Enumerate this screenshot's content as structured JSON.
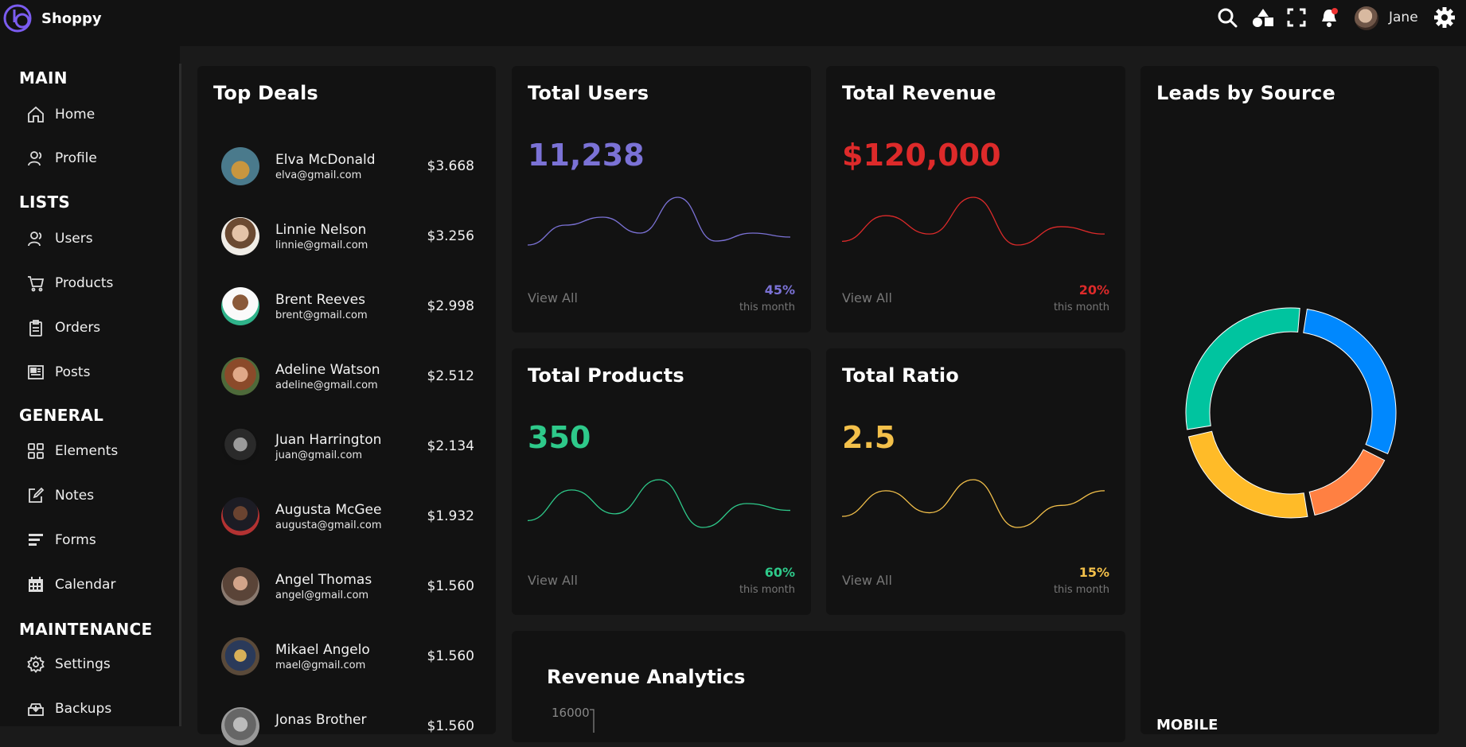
{
  "app": {
    "name": "Shoppy"
  },
  "topbar": {
    "icons": [
      "search-icon",
      "apps-icon",
      "fullscreen-icon",
      "notification-bell-icon",
      "settings-gear-icon"
    ],
    "user_name": "Jane"
  },
  "sidebar": {
    "sections": [
      {
        "title": "MAIN",
        "items": [
          {
            "label": "Home",
            "icon": "home-icon"
          },
          {
            "label": "Profile",
            "icon": "profile-icon"
          }
        ]
      },
      {
        "title": "LISTS",
        "items": [
          {
            "label": "Users",
            "icon": "users-icon"
          },
          {
            "label": "Products",
            "icon": "cart-icon"
          },
          {
            "label": "Orders",
            "icon": "clipboard-icon"
          },
          {
            "label": "Posts",
            "icon": "newspaper-icon"
          }
        ]
      },
      {
        "title": "GENERAL",
        "items": [
          {
            "label": "Elements",
            "icon": "grid-icon"
          },
          {
            "label": "Notes",
            "icon": "edit-icon"
          },
          {
            "label": "Forms",
            "icon": "forms-icon"
          },
          {
            "label": "Calendar",
            "icon": "calendar-icon"
          }
        ]
      },
      {
        "title": "MAINTENANCE",
        "items": [
          {
            "label": "Settings",
            "icon": "settings-icon"
          },
          {
            "label": "Backups",
            "icon": "backup-icon"
          }
        ]
      }
    ]
  },
  "top_deals": {
    "title": "Top Deals",
    "deals": [
      {
        "name": "Elva McDonald",
        "email": "elva@gmail.com",
        "amount": "$3.668"
      },
      {
        "name": "Linnie Nelson",
        "email": "linnie@gmail.com",
        "amount": "$3.256"
      },
      {
        "name": "Brent Reeves",
        "email": "brent@gmail.com",
        "amount": "$2.998"
      },
      {
        "name": "Adeline Watson",
        "email": "adeline@gmail.com",
        "amount": "$2.512"
      },
      {
        "name": "Juan Harrington",
        "email": "juan@gmail.com",
        "amount": "$2.134"
      },
      {
        "name": "Augusta McGee",
        "email": "augusta@gmail.com",
        "amount": "$1.932"
      },
      {
        "name": "Angel Thomas",
        "email": "angel@gmail.com",
        "amount": "$1.560"
      },
      {
        "name": "Mikael Angelo",
        "email": "mael@gmail.com",
        "amount": "$1.560"
      },
      {
        "name": "Jonas Brother",
        "email": "",
        "amount": "$1.560"
      }
    ]
  },
  "stats": [
    {
      "title": "Total Users",
      "value": "11,238",
      "color": "#7b72d6",
      "view_all": "View All",
      "percent": "45%",
      "period": "this month",
      "trend": [
        3,
        8,
        10,
        6,
        15,
        4,
        6,
        5
      ]
    },
    {
      "title": "Total Revenue",
      "value": "$120,000",
      "color": "#dd2a2a",
      "view_all": "View All",
      "percent": "20%",
      "period": "this month",
      "trend": [
        3,
        10,
        5,
        15,
        2,
        7,
        5
      ]
    },
    {
      "title": "Total Products",
      "value": "350",
      "color": "#2ec98a",
      "view_all": "View All",
      "percent": "60%",
      "period": "this month",
      "trend": [
        3,
        12,
        5,
        15,
        1,
        8,
        6
      ]
    },
    {
      "title": "Total Ratio",
      "value": "2.5",
      "color": "#f3c04a",
      "view_all": "View All",
      "percent": "15%",
      "period": "this month",
      "trend": [
        5,
        12,
        6,
        15,
        2,
        8,
        12
      ]
    }
  ],
  "leads": {
    "title": "Leads by Source",
    "footer_label": "MOBILE"
  },
  "revenue": {
    "title": "Revenue Analytics",
    "axis_top": "16000"
  },
  "chart_data": {
    "type": "pie",
    "title": "Leads by Source",
    "series": [
      {
        "color": "#0088fe",
        "value": 30
      },
      {
        "color": "#ff8042",
        "value": 15
      },
      {
        "color": "#ffbb28",
        "value": 25
      },
      {
        "color": "#00c49f",
        "value": 30
      }
    ]
  }
}
